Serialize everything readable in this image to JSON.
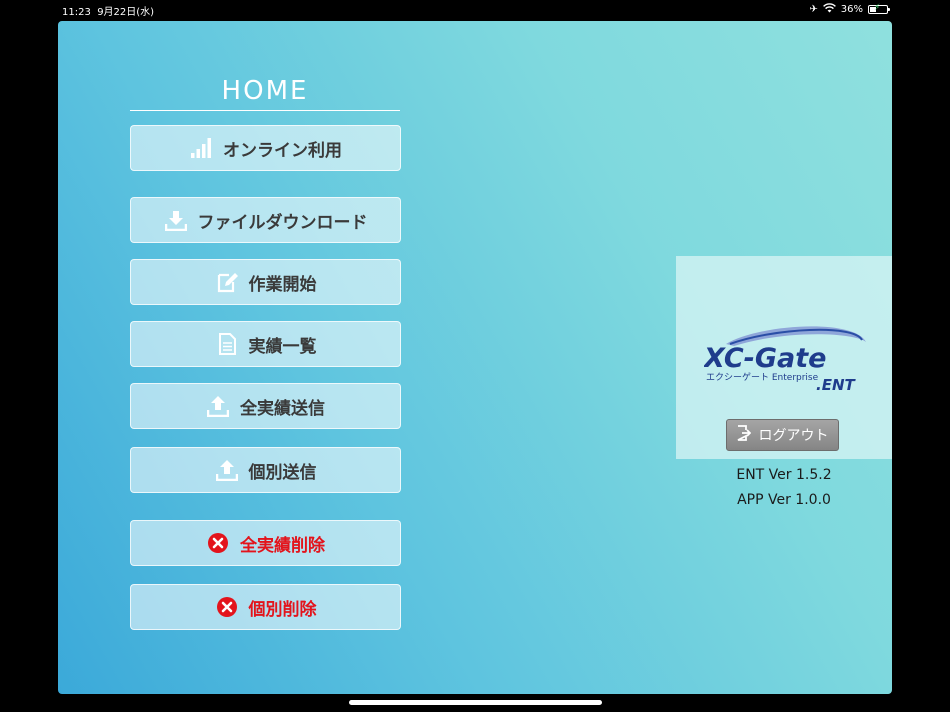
{
  "status_bar": {
    "time": "11:23",
    "date": "9月22日(水)",
    "battery": "36%",
    "battery_level": 0.36
  },
  "home": {
    "title": "HOME",
    "buttons": [
      {
        "label": "オンライン利用",
        "icon": "signal-icon"
      },
      {
        "label": "ファイルダウンロード",
        "icon": "download-icon"
      },
      {
        "label": "作業開始",
        "icon": "edit-icon"
      },
      {
        "label": "実績一覧",
        "icon": "document-icon"
      },
      {
        "label": "全実績送信",
        "icon": "upload-icon"
      },
      {
        "label": "個別送信",
        "icon": "upload-icon"
      },
      {
        "label": "全実績削除",
        "icon": "delete-icon"
      },
      {
        "label": "個別削除",
        "icon": "delete-icon"
      }
    ]
  },
  "side": {
    "logo_main": "XC-Gate",
    "logo_sub": "エクシーゲート Enterprise",
    "logo_suffix": ".ENT",
    "logout_label": "ログアウト",
    "ent_version": "ENT Ver 1.5.2",
    "app_version": "APP Ver 1.0.0"
  },
  "colors": {
    "danger": "#e3141c",
    "logo_blue": "#1f3c8c"
  }
}
